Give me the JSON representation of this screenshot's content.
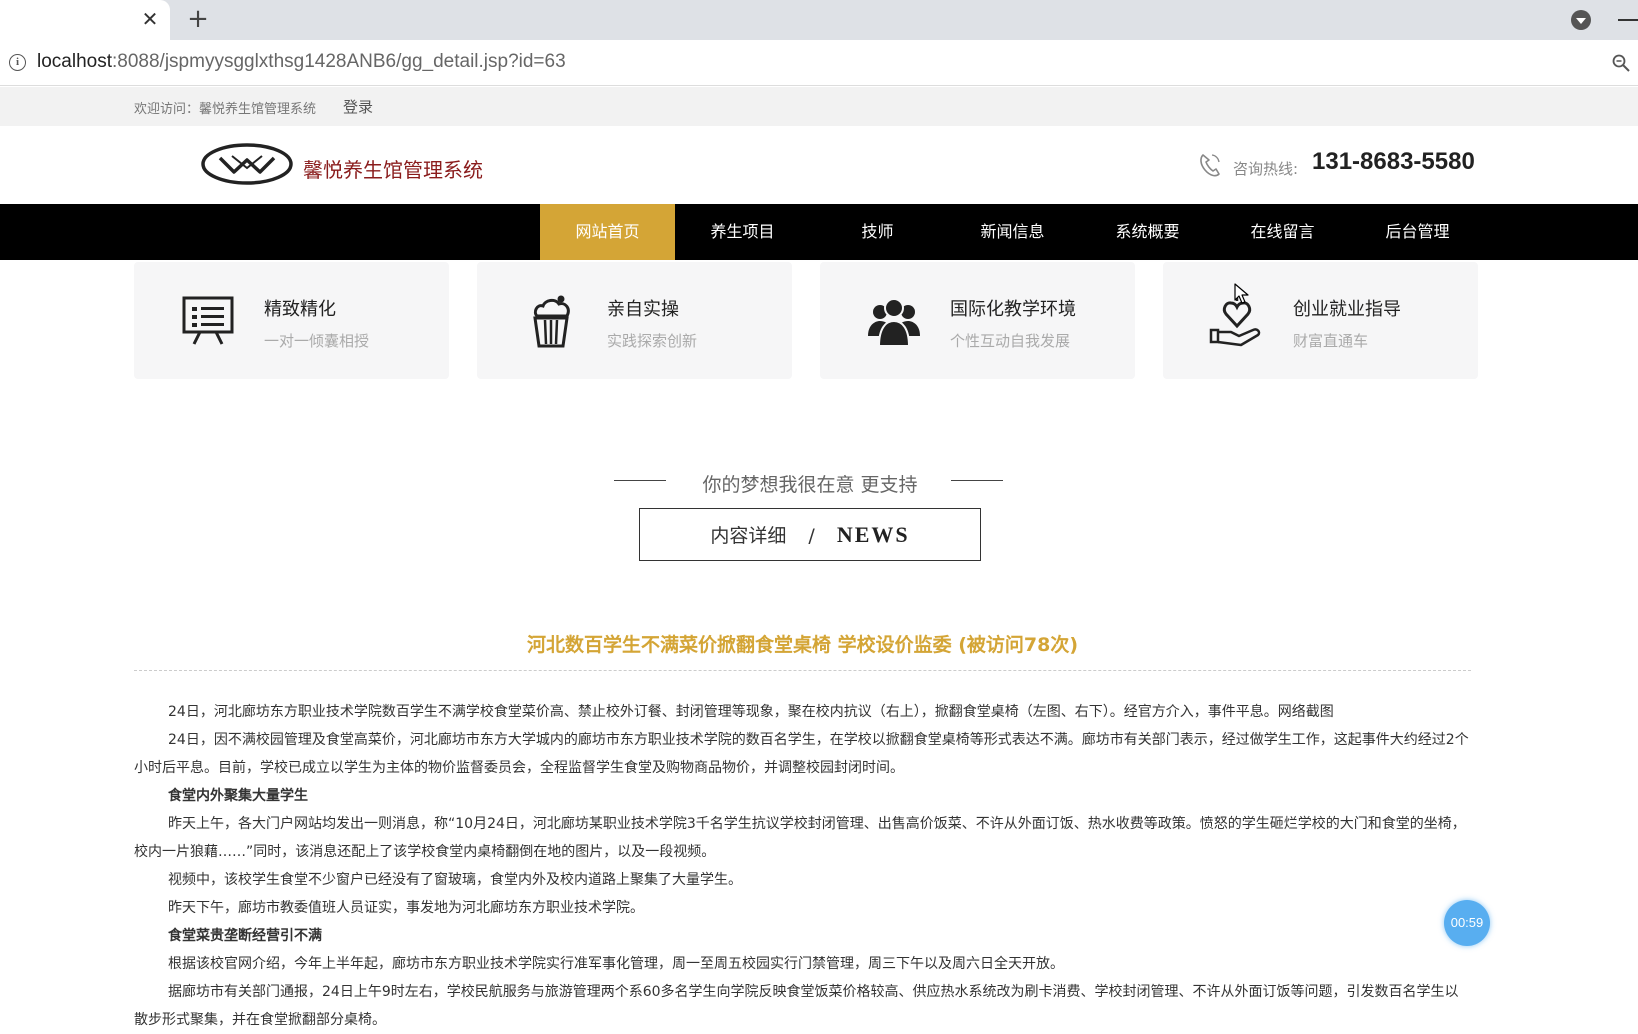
{
  "browser": {
    "tab_close": "✕",
    "new_tab": "+",
    "url_host": "localhost",
    "url_rest": ":8088/jspmyysgglxthsg1428ANB6/gg_detail.jsp?id=63"
  },
  "topbar": {
    "welcome": "欢迎访问：馨悦养生馆管理系统",
    "login": "登录"
  },
  "header": {
    "site_name": "馨悦养生馆管理系统",
    "hotline_label": "咨询热线:",
    "hotline_number": "131-8683-5580"
  },
  "nav": {
    "items": [
      {
        "label": "网站首页",
        "active": true
      },
      {
        "label": "养生项目"
      },
      {
        "label": "技师"
      },
      {
        "label": "新闻信息"
      },
      {
        "label": "系统概要"
      },
      {
        "label": "在线留言"
      },
      {
        "label": "后台管理"
      }
    ]
  },
  "features": [
    {
      "title": "精致精化",
      "subtitle": "一对一倾囊相授",
      "icon": "presentation-board-icon"
    },
    {
      "title": "亲自实操",
      "subtitle": "实践探索创新",
      "icon": "cupcake-icon"
    },
    {
      "title": "国际化教学环境",
      "subtitle": "个性互动自我发展",
      "icon": "people-group-icon"
    },
    {
      "title": "创业就业指导",
      "subtitle": "财富直通车",
      "icon": "heart-hand-icon"
    }
  ],
  "section": {
    "tagline": "你的梦想我很在意 更支持",
    "heading_cn": "内容详细",
    "heading_slash": "/",
    "heading_en": "NEWS"
  },
  "article": {
    "title": "河北数百学生不满菜价掀翻食堂桌椅 学校设价监委 (被访问78次)",
    "paragraphs": [
      {
        "text": "24日，河北廊坊东方职业技术学院数百学生不满学校食堂菜价高、禁止校外订餐、封闭管理等现象，聚在校内抗议（右上），掀翻食堂桌椅（左图、右下）。经官方介入，事件平息。网络截图",
        "bold": false
      },
      {
        "text": "24日，因不满校园管理及食堂高菜价，河北廊坊市东方大学城内的廊坊市东方职业技术学院的数百名学生，在学校以掀翻食堂桌椅等形式表达不满。廊坊市有关部门表示，经过做学生工作，这起事件大约经过2个小时后平息。目前，学校已成立以学生为主体的物价监督委员会，全程监督学生食堂及购物商品物价，并调整校园封闭时间。",
        "bold": false
      },
      {
        "text": "食堂内外聚集大量学生",
        "bold": true
      },
      {
        "text": "昨天上午，各大门户网站均发出一则消息，称“10月24日，河北廊坊某职业技术学院3千名学生抗议学校封闭管理、出售高价饭菜、不许从外面订饭、热水收费等政策。愤怒的学生砸烂学校的大门和食堂的坐椅，校内一片狼藉……”同时，该消息还配上了该学校食堂内桌椅翻倒在地的图片，以及一段视频。",
        "bold": false
      },
      {
        "text": "视频中，该校学生食堂不少窗户已经没有了窗玻璃，食堂内外及校内道路上聚集了大量学生。",
        "bold": false
      },
      {
        "text": "昨天下午，廊坊市教委值班人员证实，事发地为河北廊坊东方职业技术学院。",
        "bold": false
      },
      {
        "text": "食堂菜贵垄断经营引不满",
        "bold": true
      },
      {
        "text": "根据该校官网介绍，今年上半年起，廊坊市东方职业技术学院实行准军事化管理，周一至周五校园实行门禁管理，周三下午以及周六日全天开放。",
        "bold": false
      },
      {
        "text": "据廊坊市有关部门通报，24日上午9时左右，学校民航服务与旅游管理两个系60多名学生向学院反映食堂饭菜价格较高、供应热水系统改为刷卡消费、学校封闭管理、不许从外面订饭等问题，引发数百名学生以散步形式聚集，并在食堂掀翻部分桌椅。",
        "bold": false
      }
    ]
  },
  "timer": "00:59",
  "colors": {
    "accent": "#d4a536",
    "nav_bg": "#000000",
    "brand": "#8a1c1c",
    "timer": "#58aef0"
  }
}
